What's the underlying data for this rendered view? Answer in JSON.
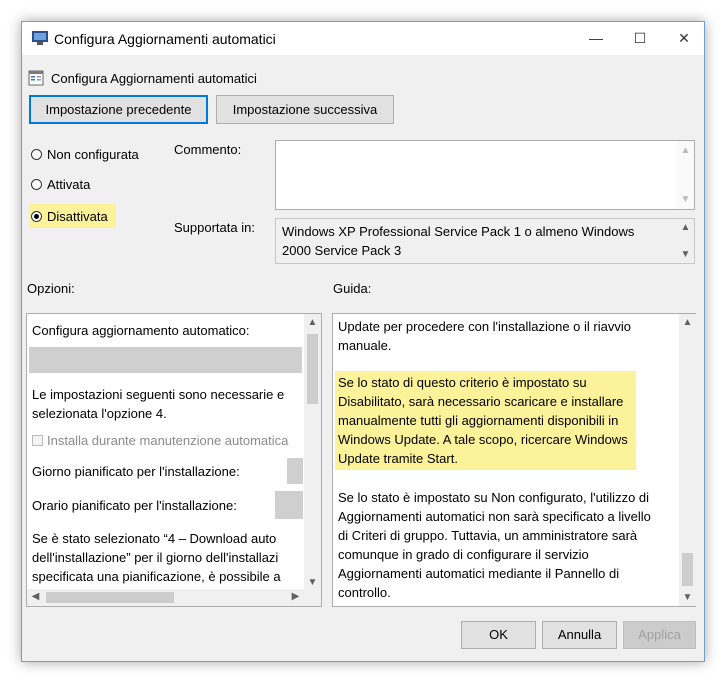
{
  "window": {
    "title": "Configura Aggiornamenti automatici",
    "controls": {
      "minimize": "—",
      "maximize": "☐",
      "close": "✕"
    }
  },
  "header": {
    "policy_name": "Configura Aggiornamenti automatici",
    "prev_button": "Impostazione precedente",
    "next_button": "Impostazione successiva"
  },
  "state": {
    "options": [
      {
        "label": "Non configurata",
        "selected": false
      },
      {
        "label": "Attivata",
        "selected": false
      },
      {
        "label": "Disattivata",
        "selected": true
      }
    ]
  },
  "comment": {
    "label": "Commento:",
    "value": ""
  },
  "supported": {
    "label": "Supportata in:",
    "line1": "Windows XP Professional Service Pack 1 o almeno Windows",
    "line2": "2000 Service Pack 3"
  },
  "options_pane": {
    "label": "Opzioni:",
    "configure_label": "Configura aggiornamento automatico:",
    "note_line1": "Le impostazioni seguenti sono necessarie e",
    "note_line2": "selezionata l'opzione 4.",
    "maintenance_checkbox": "Installa durante manutenzione automatica",
    "day_label": "Giorno pianificato per l'installazione:",
    "time_label": "Orario pianificato per l'installazione:",
    "long_line1": "Se è stato selezionato “4 – Download auto",
    "long_line2": "dell'installazione” per il giorno dell'installazi",
    "long_line3": "specificata una pianificazione, è possibile a"
  },
  "help_pane": {
    "label": "Guida:",
    "p1_line1": "Update per procedere con l'installazione o il riavvio",
    "p1_line2": "manuale.",
    "p2_line1": "Se lo stato di questo criterio è impostato su",
    "p2_line2": "Disabilitato, sarà necessario scaricare e installare",
    "p2_line3": "manualmente tutti gli aggiornamenti disponibili in",
    "p2_line4": "Windows Update. A tale scopo, ricercare Windows",
    "p2_line5": "Update tramite Start.",
    "p3_line1": "Se lo stato è impostato su Non configurato, l'utilizzo di",
    "p3_line2": "Aggiornamenti automatici non sarà specificato a livello",
    "p3_line3": "di Criteri di gruppo. Tuttavia, un amministratore sarà",
    "p3_line4": "comunque in grado di configurare il servizio",
    "p3_line5": "Aggiornamenti automatici mediante il Pannello di",
    "p3_line6": "controllo."
  },
  "footer": {
    "ok": "OK",
    "cancel": "Annulla",
    "apply": "Applica"
  },
  "colors": {
    "highlight": "#fbf29a",
    "focus": "#0078d7"
  }
}
